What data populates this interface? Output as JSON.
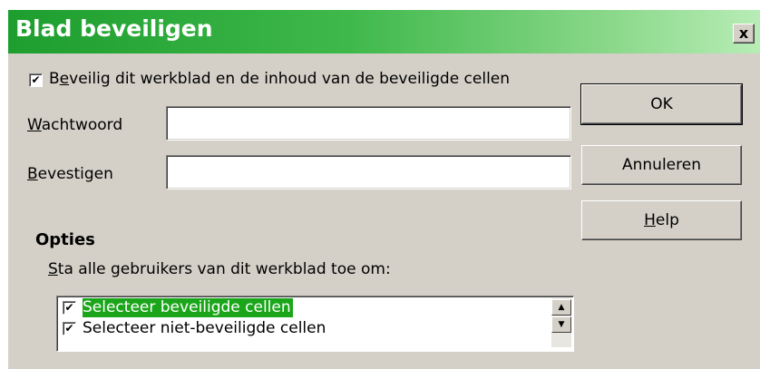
{
  "window": {
    "title": "Blad beveiligen",
    "close_glyph": "x"
  },
  "protect": {
    "checked": true,
    "label_first": "B",
    "label_accel": "e",
    "label_rest": "veilig dit werkblad en de inhoud van de beveiligde cellen"
  },
  "password": {
    "label_accel": "W",
    "label_rest": "achtwoord",
    "value": ""
  },
  "confirm": {
    "label_accel": "B",
    "label_rest": "evestigen",
    "value": ""
  },
  "buttons": {
    "ok": "OK",
    "cancel": "Annuleren",
    "help_accel": "H",
    "help_rest": "elp"
  },
  "options": {
    "title": "Opties",
    "allow_accel": "S",
    "allow_rest": "ta alle gebruikers van dit werkblad toe om:",
    "items": [
      {
        "label": "Selecteer beveiligde cellen",
        "checked": true,
        "selected": true
      },
      {
        "label": "Selecteer niet-beveiligde cellen",
        "checked": true,
        "selected": false
      }
    ]
  },
  "icons": {
    "check": "✔",
    "scroll_up": "▲",
    "scroll_down": "▼"
  },
  "colors": {
    "title_gradient_start": "#1d9e2e",
    "title_gradient_end": "#b8ecb6",
    "selection": "#1aa51a",
    "dialog_bg": "#d4d0c8"
  }
}
